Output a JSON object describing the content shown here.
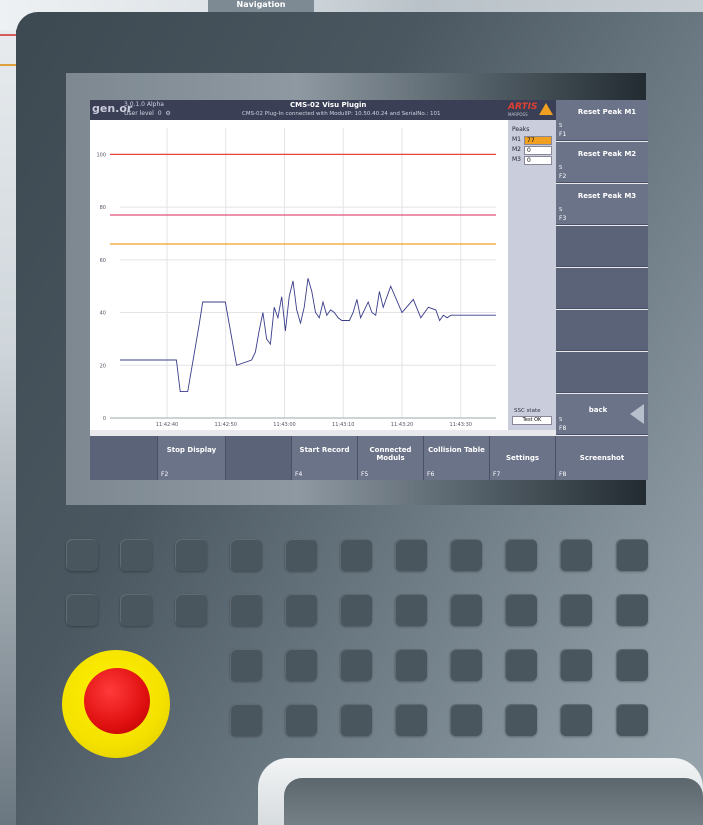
{
  "top_bar": {
    "tab_label": "Navigation"
  },
  "header": {
    "logo_text": "gen.or",
    "version": "3.0.1.0 Alpha",
    "user_level": "User level",
    "user_level_value": "0",
    "title": "CMS-02 Visu Plugin",
    "status": "CMS-02 Plug-In connected with ModulIP: 10.50.40.24 and SerialNo.: 101",
    "brand": "ARTIS",
    "brand_sub": "MARPOSS"
  },
  "peaks": {
    "label": "Peaks",
    "items": [
      {
        "name": "M1",
        "value": "77"
      },
      {
        "name": "M2",
        "value": "0"
      },
      {
        "name": "M3",
        "value": "0"
      }
    ],
    "ssc_label": "SSC state",
    "ssc_value": "Test OK"
  },
  "right_softkeys": [
    {
      "label": "Reset Peak M1",
      "s": "S",
      "f": "F1"
    },
    {
      "label": "Reset Peak M2",
      "s": "S",
      "f": "F2"
    },
    {
      "label": "Reset Peak M3",
      "s": "S",
      "f": "F3"
    },
    {
      "label": "",
      "s": "",
      "f": ""
    },
    {
      "label": "",
      "s": "",
      "f": ""
    },
    {
      "label": "",
      "s": "",
      "f": ""
    },
    {
      "label": "",
      "s": "",
      "f": ""
    },
    {
      "label": "back",
      "s": "S",
      "f": "F8"
    }
  ],
  "bottom_softkeys": [
    {
      "label": "",
      "f": ""
    },
    {
      "label": "Stop Display",
      "f": "F2"
    },
    {
      "label": "",
      "f": ""
    },
    {
      "label": "Start Record",
      "f": "F4"
    },
    {
      "label": "Connected Moduls",
      "f": "F5"
    },
    {
      "label": "Collision Table",
      "f": "F6"
    },
    {
      "label": "Settings",
      "f": "F7"
    },
    {
      "label": "Screenshot",
      "f": "F8"
    }
  ],
  "colors": {
    "limit_red": "#e8453c",
    "limit_pink": "#e0507a",
    "limit_orange": "#f0a020",
    "signal": "#3a3d8a"
  },
  "chart_data": {
    "type": "line",
    "ylim": [
      0,
      110
    ],
    "yticks": [
      0,
      20,
      40,
      60,
      80,
      100
    ],
    "xticks": [
      "11:42:40",
      "11:42:50",
      "11:43:00",
      "11:43:10",
      "11:43:20",
      "11:43:30"
    ],
    "limits": [
      {
        "y": 100,
        "color": "#e8453c"
      },
      {
        "y": 77,
        "color": "#e0507a"
      },
      {
        "y": 66,
        "color": "#f0a020"
      }
    ],
    "series": [
      {
        "x": [
          0,
          8,
          15,
          16,
          18,
          21,
          22,
          24,
          25,
          27,
          28,
          31,
          35,
          36,
          37,
          38,
          39,
          40,
          41,
          42,
          43,
          44,
          45,
          46,
          47,
          48,
          49,
          50,
          51,
          52,
          53,
          54,
          55,
          56,
          57,
          58,
          59,
          60,
          61,
          62,
          63,
          64,
          65,
          66,
          67,
          68,
          69,
          70,
          72,
          75,
          78,
          80,
          82,
          84,
          85,
          86,
          87,
          88,
          89,
          90,
          91,
          92,
          93,
          94,
          95,
          96,
          97,
          98,
          99,
          100
        ],
        "y": [
          22,
          22,
          22,
          10,
          10,
          35,
          44,
          44,
          44,
          44,
          44,
          20,
          22,
          25,
          33,
          40,
          30,
          28,
          42,
          38,
          46,
          33,
          46,
          52,
          41,
          36,
          42,
          53,
          48,
          40,
          38,
          44,
          39,
          41,
          40,
          38,
          37,
          37,
          37,
          40,
          45,
          38,
          41,
          44,
          40,
          39,
          48,
          42,
          50,
          40,
          45,
          38,
          42,
          41,
          37,
          39,
          38,
          39,
          39,
          39,
          39,
          39,
          39,
          39,
          39,
          39,
          39,
          39,
          39,
          39
        ]
      }
    ]
  }
}
